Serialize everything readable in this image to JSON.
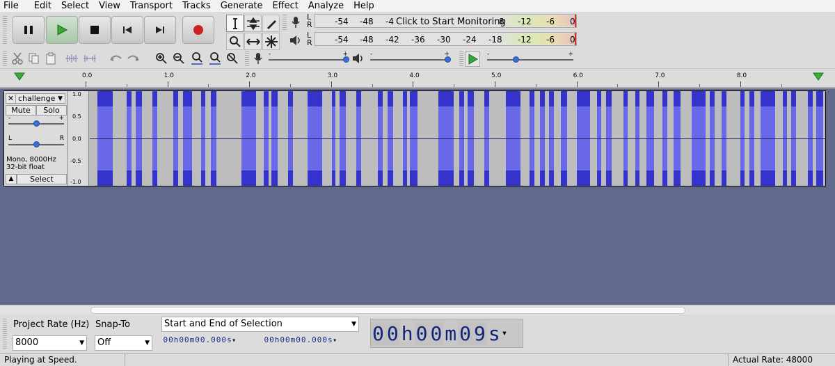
{
  "menu": [
    "File",
    "Edit",
    "Select",
    "View",
    "Transport",
    "Tracks",
    "Generate",
    "Effect",
    "Analyze",
    "Help"
  ],
  "transport": {
    "icons": [
      "pause-icon",
      "play-icon",
      "stop-icon",
      "skip-start-icon",
      "skip-end-icon",
      "record-icon"
    ],
    "play_color": "#3aa53a",
    "record_color": "#cc2222"
  },
  "tools": [
    "selection-tool-icon",
    "envelope-tool-icon",
    "draw-tool-icon",
    "zoom-tool-icon",
    "timeshift-tool-icon",
    "multi-tool-icon"
  ],
  "meters": {
    "record": {
      "channels": [
        "L",
        "R"
      ],
      "ticks": [
        "-54",
        "-48",
        "-4",
        "8",
        "-12",
        "-6",
        "0"
      ],
      "prompt": "Click to Start Monitoring"
    },
    "playback": {
      "channels": [
        "L",
        "R"
      ],
      "ticks": [
        "-54",
        "-48",
        "-42",
        "-36",
        "-30",
        "-24",
        "-18",
        "-12",
        "-6",
        "0"
      ]
    }
  },
  "mixer": {
    "rec_slider_min": "-",
    "rec_slider_max": "+",
    "play_slider_min": "-",
    "play_slider_max": "+",
    "speed_slider_min": "-",
    "speed_slider_max": "+"
  },
  "ruler": {
    "labels": [
      "0.0",
      "1.0",
      "2.0",
      "3.0",
      "4.0",
      "5.0",
      "6.0",
      "7.0",
      "8.0"
    ]
  },
  "track": {
    "name": "challenge",
    "close": "✕",
    "mute": "Mute",
    "solo": "Solo",
    "gain_min": "-",
    "gain_max": "+",
    "pan_left": "L",
    "pan_right": "R",
    "info_line1": "Mono, 8000Hz",
    "info_line2": "32-bit float",
    "collapse": "▲",
    "select": "Select",
    "vruler": [
      "1.0",
      "0.5",
      "0.0",
      "-0.5",
      "-1.0"
    ],
    "wave_color": "#3434cc",
    "wave_rms_color": "#6868e8"
  },
  "waveform_segments_seconds": [
    [
      0.1,
      0.29
    ],
    [
      0.47,
      0.53
    ],
    [
      0.58,
      0.66
    ],
    [
      0.79,
      0.85
    ],
    [
      1.06,
      1.12
    ],
    [
      1.18,
      1.29
    ],
    [
      1.41,
      1.46
    ],
    [
      1.53,
      1.6
    ],
    [
      1.92,
      2.1
    ],
    [
      2.2,
      2.26
    ],
    [
      2.3,
      2.38
    ],
    [
      2.51,
      2.57
    ],
    [
      2.75,
      2.94
    ],
    [
      3.06,
      3.11
    ],
    [
      3.16,
      3.24
    ],
    [
      3.37,
      3.43
    ],
    [
      3.64,
      3.7
    ],
    [
      3.77,
      3.84
    ],
    [
      3.96,
      4.01
    ],
    [
      4.05,
      4.14
    ],
    [
      4.41,
      4.6
    ],
    [
      4.67,
      4.73
    ],
    [
      4.78,
      4.86
    ],
    [
      4.99,
      5.05
    ],
    [
      5.26,
      5.45
    ],
    [
      5.56,
      5.62
    ],
    [
      5.69,
      5.75
    ],
    [
      5.81,
      5.87
    ],
    [
      5.96,
      6.04
    ],
    [
      6.16,
      6.33
    ],
    [
      6.41,
      6.47
    ],
    [
      6.53,
      6.6
    ],
    [
      6.75,
      6.8
    ],
    [
      6.9,
      6.95
    ],
    [
      7.04,
      7.14
    ],
    [
      7.24,
      7.3
    ],
    [
      7.38,
      7.47
    ],
    [
      7.61,
      7.79
    ],
    [
      7.84,
      7.9
    ],
    [
      7.99,
      8.05
    ],
    [
      8.23,
      8.28
    ],
    [
      8.34,
      8.4
    ],
    [
      8.48,
      8.67
    ],
    [
      8.76,
      8.82
    ],
    [
      8.87,
      8.93
    ],
    [
      9.08,
      9.14
    ],
    [
      9.19,
      9.27
    ]
  ],
  "timeline_seconds_visible": 9.3,
  "selection_toolbar": {
    "project_rate_label": "Project Rate (Hz)",
    "project_rate_value": "8000",
    "snap_to_label": "Snap-To",
    "snap_to_value": "Off",
    "selection_mode": "Start and End of Selection",
    "start_time": [
      "0",
      "0",
      "h",
      "0",
      "0",
      "m",
      "0",
      "0",
      ".",
      "0",
      "0",
      "0",
      "s"
    ],
    "end_time": [
      "0",
      "0",
      "h",
      "0",
      "0",
      "m",
      "0",
      "0",
      ".",
      "0",
      "0",
      "0",
      "s"
    ],
    "audio_position": [
      "0",
      "0",
      "h",
      "0",
      "0",
      "m",
      "0",
      "9",
      "s"
    ]
  },
  "status": {
    "left": "Playing at Speed.",
    "right": "Actual Rate: 48000"
  }
}
